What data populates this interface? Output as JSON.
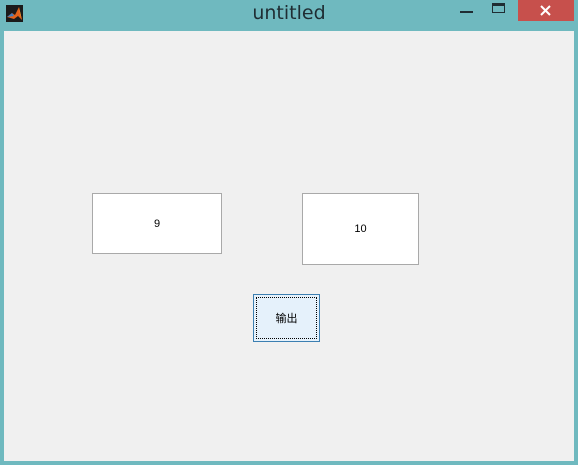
{
  "window": {
    "title": "untitled",
    "icon": "matlab-icon",
    "controls": [
      "minimize-icon",
      "maximize-icon",
      "close-icon"
    ]
  },
  "figure": {
    "edit1_value": "9",
    "edit2_value": "10",
    "button_label": "输出"
  },
  "colors": {
    "frame": "#6fb9bf",
    "client": "#f0f0f0",
    "close": "#c7504c",
    "button_focus": "#e5f1fb"
  }
}
